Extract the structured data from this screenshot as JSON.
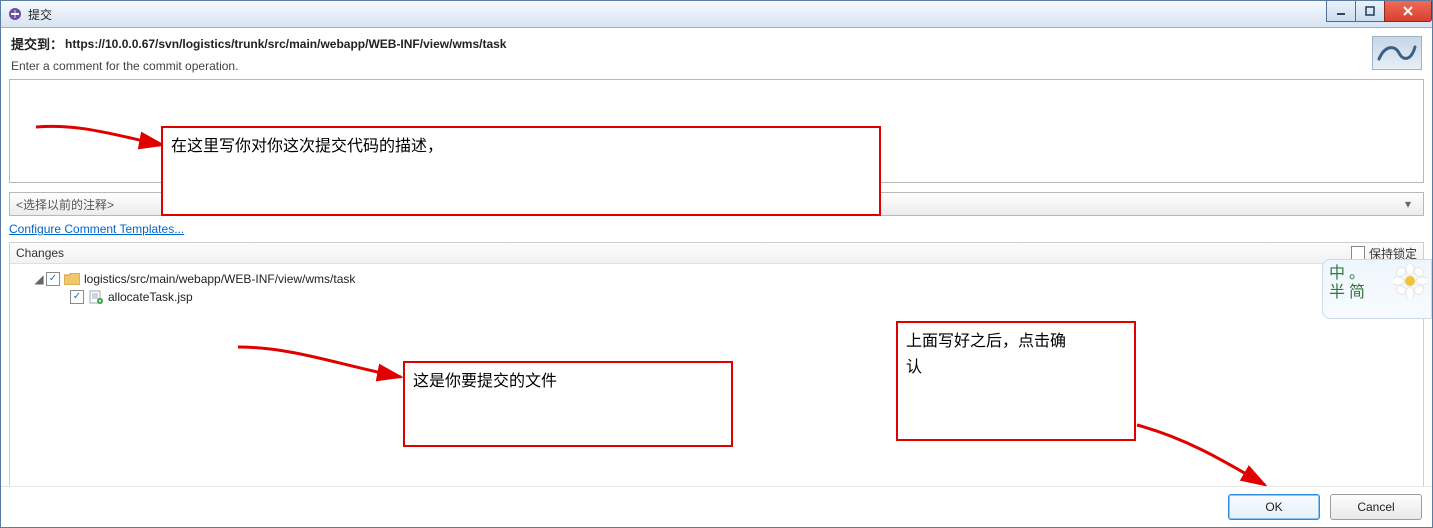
{
  "titlebar": {
    "title": "提交"
  },
  "header": {
    "prefix": "提交到：",
    "url": "https://10.0.0.67/svn/logistics/trunk/src/main/webapp/WEB-INF/view/wms/task",
    "hint": "Enter a comment for the commit operation."
  },
  "comment": {
    "value": ""
  },
  "prev_combo": {
    "label": "<选择以前的注释>"
  },
  "links": {
    "configure_templates": "Configure Comment Templates..."
  },
  "changes": {
    "title": "Changes",
    "keep_locks_label": "保持锁定",
    "keep_locks_checked": false,
    "tree": {
      "folder": {
        "path": "logistics/src/main/webapp/WEB-INF/view/wms/task",
        "checked": true
      },
      "file": {
        "name": "allocateTask.jsp",
        "checked": true
      }
    }
  },
  "annotations": {
    "comment_hint": "在这里写你对你这次提交代码的描述，",
    "file_hint": "这是你要提交的文件",
    "ok_hint_line1": "上面写好之后，点击确",
    "ok_hint_line2": "认"
  },
  "ime": {
    "line1": "中 。",
    "line2": "半 简"
  },
  "buttons": {
    "ok": "OK",
    "cancel": "Cancel"
  }
}
